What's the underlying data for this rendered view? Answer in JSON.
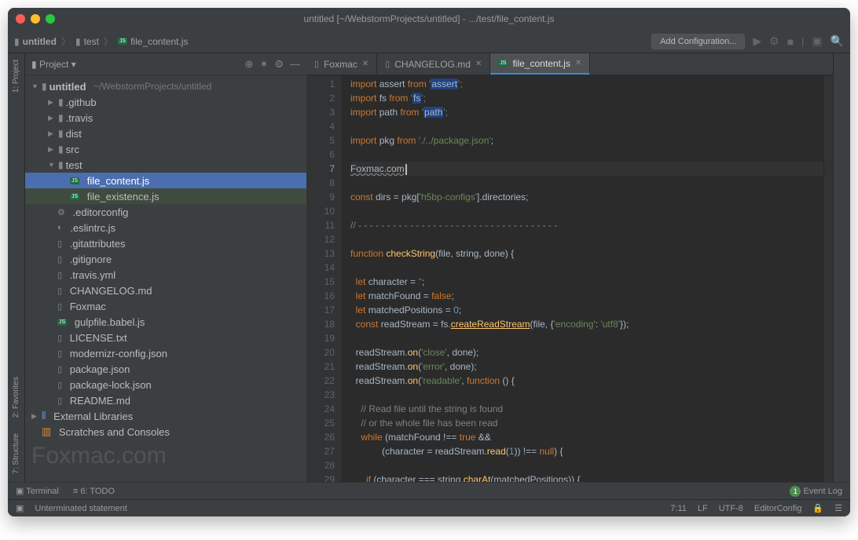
{
  "window": {
    "title": "untitled [~/WebstormProjects/untitled] - .../test/file_content.js"
  },
  "breadcrumb": {
    "root": "untitled",
    "p1": "test",
    "p2": "file_content.js"
  },
  "toolbar": {
    "addconfig": "Add Configuration..."
  },
  "sidebar": {
    "header": "Project",
    "tree": {
      "root": "untitled",
      "rootPath": "~/WebstormProjects/untitled",
      "items": [
        ".github",
        ".travis",
        "dist",
        "src",
        "test",
        "file_content.js",
        "file_existence.js",
        ".editorconfig",
        ".eslintrc.js",
        ".gitattributes",
        ".gitignore",
        ".travis.yml",
        "CHANGELOG.md",
        "Foxmac",
        "gulpfile.babel.js",
        "LICENSE.txt",
        "modernizr-config.json",
        "package.json",
        "package-lock.json",
        "README.md"
      ],
      "extlib": "External Libraries",
      "scratches": "Scratches and Consoles"
    }
  },
  "tabs": {
    "t0": "Foxmac",
    "t1": "CHANGELOG.md",
    "t2": "file_content.js"
  },
  "code": {
    "l1": {
      "a": "import ",
      "b": "assert",
      "c": " from ",
      "d": "'",
      "e": "assert",
      "f": "';"
    },
    "l2": {
      "a": "import ",
      "b": "fs",
      "c": " from ",
      "d": "'",
      "e": "fs",
      "f": "';"
    },
    "l3": {
      "a": "import ",
      "b": "path",
      "c": " from ",
      "d": "'",
      "e": "path",
      "f": "';"
    },
    "l5": {
      "a": "import ",
      "b": "pkg",
      "c": " from ",
      "d": "'./../package.json'",
      "e": ";"
    },
    "l7": "Foxmac.com",
    "l9": {
      "a": "const ",
      "b": "dirs = pkg[",
      "c": "'h5bp-configs'",
      "d": "].directories;"
    },
    "l11": "// - - - - - - - - - - - - - - - - - - - - - - - - - - - - - - - - - - -",
    "l13": {
      "a": "function ",
      "b": "checkString",
      "c": "(file, string, done) {"
    },
    "l15": {
      "a": "  let ",
      "b": "character = ",
      "c": "''",
      "d": ";"
    },
    "l16": {
      "a": "  let ",
      "b": "matchFound = ",
      "c": "false",
      "d": ";"
    },
    "l17": {
      "a": "  let ",
      "b": "matchedPositions = ",
      "c": "0",
      "d": ";"
    },
    "l18": {
      "a": "  const ",
      "b": "readStream = fs.",
      "c": "createReadStream",
      "d": "(file, {",
      "e": "'encoding'",
      "f": ": ",
      "g": "'utf8'",
      "h": "});"
    },
    "l20": {
      "a": "  readStream.",
      "b": "on",
      "c": "(",
      "d": "'close'",
      "e": ", done);"
    },
    "l21": {
      "a": "  readStream.",
      "b": "on",
      "c": "(",
      "d": "'error'",
      "e": ", done);"
    },
    "l22": {
      "a": "  readStream.",
      "b": "on",
      "c": "(",
      "d": "'readable'",
      "e": ", ",
      "f": "function ",
      "g": "() {"
    },
    "l24": "    // Read file until the string is found",
    "l25": "    // or the whole file has been read",
    "l26": {
      "a": "    while ",
      "b": "(matchFound !== ",
      "c": "true ",
      "d": "&&"
    },
    "l27": {
      "a": "            (character = readStream.",
      "b": "read",
      "c": "(",
      "d": "1",
      "e": ")) !== ",
      "f": "null",
      "g": ") {"
    },
    "l29": {
      "a": "      if ",
      "b": "(character === string.",
      "c": "charAt",
      "d": "(matchedPositions)) {"
    }
  },
  "bottombar": {
    "terminal": "Terminal",
    "todo": "6: TODO",
    "eventlog": "Event Log"
  },
  "status": {
    "msg": "Unterminated statement",
    "pos": "7:11",
    "le": "LF",
    "enc": "UTF-8",
    "cfg": "EditorConfig"
  },
  "rails": {
    "project": "1: Project",
    "fav": "2: Favorites",
    "struct": "7: Structure"
  },
  "watermark": "Foxmac.com"
}
